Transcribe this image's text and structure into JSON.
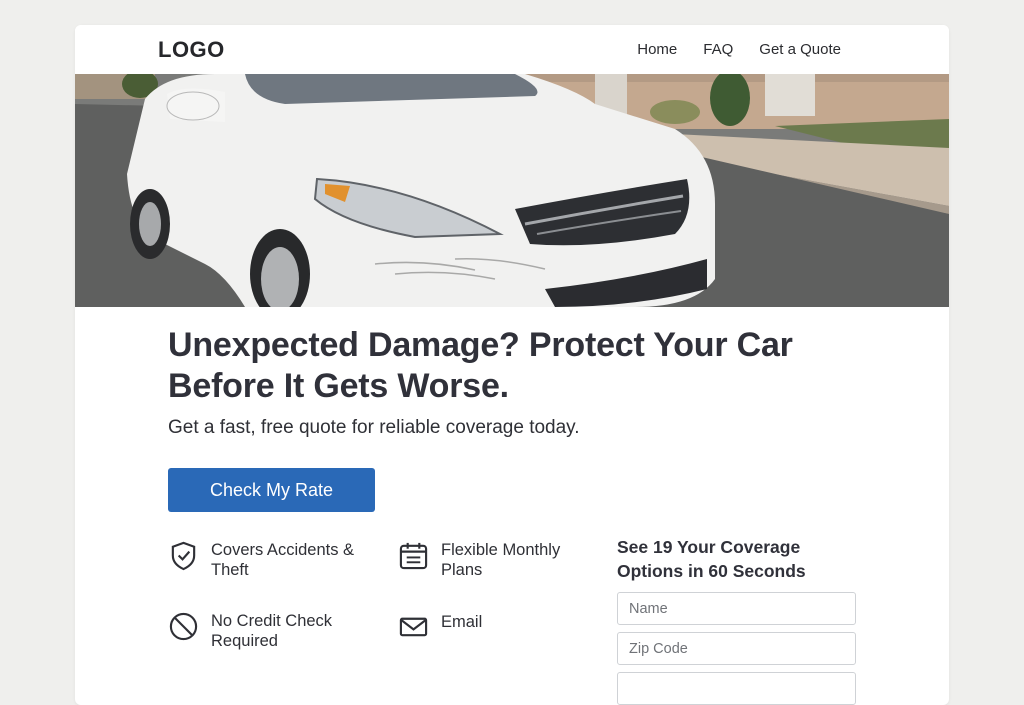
{
  "header": {
    "logo": "LOGO",
    "nav": [
      "Home",
      "FAQ",
      "Get a Quote"
    ]
  },
  "hero": {
    "image_description": "white sedan with scratched front bumper parked on street"
  },
  "main": {
    "headline": "Unexpected Damage? Protect Your Car Before It Gets Worse.",
    "subheadline": "Get a fast, free quote for reliable coverage today.",
    "cta_label": "Check My Rate"
  },
  "features": [
    {
      "icon": "shield-check-icon",
      "text": "Covers Accidents & Theft"
    },
    {
      "icon": "calendar-icon",
      "text": "Flexible Monthly Plans"
    },
    {
      "icon": "no-symbol-icon",
      "text": "No Credit Check Required"
    },
    {
      "icon": "envelope-icon",
      "text": "Email"
    }
  ],
  "quote_form": {
    "title": "See 19 Your Coverage Options in 60 Seconds",
    "name_placeholder": "Name",
    "zip_placeholder": "Zip Code"
  },
  "colors": {
    "page_background": "#efefed",
    "card_background": "#ffffff",
    "primary_button": "#2a69b7",
    "text": "#2f3036"
  }
}
